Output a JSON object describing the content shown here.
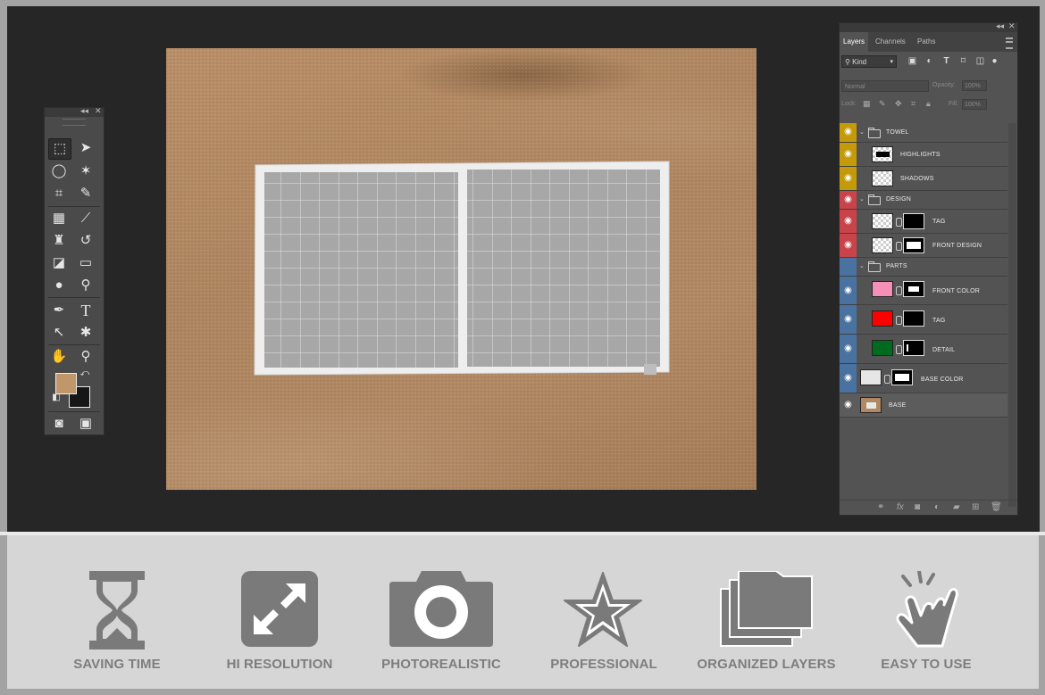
{
  "toolbar": {
    "collapse_glyph": "◂◂",
    "close_glyph": "✕",
    "tools": [
      {
        "name": "marquee-tool",
        "icon": "dashed-rectangle-icon",
        "glyph": "⬚"
      },
      {
        "name": "move-tool",
        "icon": "move-arrow-icon",
        "glyph": "➤"
      },
      {
        "name": "lasso-tool",
        "icon": "lasso-icon",
        "glyph": "◯"
      },
      {
        "name": "magic-wand-tool",
        "icon": "magic-wand-icon",
        "glyph": "✶"
      },
      {
        "name": "crop-tool",
        "icon": "crop-icon",
        "glyph": "⌗"
      },
      {
        "name": "eyedropper-tool",
        "icon": "eyedropper-icon",
        "glyph": "✎"
      },
      {
        "name": "healing-tool",
        "icon": "bandage-icon",
        "glyph": "▦"
      },
      {
        "name": "brush-tool",
        "icon": "brush-icon",
        "glyph": "⟋"
      },
      {
        "name": "stamp-tool",
        "icon": "stamp-icon",
        "glyph": "♜"
      },
      {
        "name": "history-brush-tool",
        "icon": "history-brush-icon",
        "glyph": "↺"
      },
      {
        "name": "eraser-tool",
        "icon": "eraser-icon",
        "glyph": "◪"
      },
      {
        "name": "gradient-tool",
        "icon": "gradient-icon",
        "glyph": "▭"
      },
      {
        "name": "blur-tool",
        "icon": "drop-icon",
        "glyph": "●"
      },
      {
        "name": "dodge-tool",
        "icon": "dodge-icon",
        "glyph": "⚲"
      },
      {
        "name": "pen-tool",
        "icon": "pen-icon",
        "glyph": "✒"
      },
      {
        "name": "type-tool",
        "icon": "type-icon",
        "glyph": "T"
      },
      {
        "name": "path-selection-tool",
        "icon": "arrow-icon",
        "glyph": "↖"
      },
      {
        "name": "custom-shape-tool",
        "icon": "custom-shape-icon",
        "glyph": "✱"
      },
      {
        "name": "hand-tool",
        "icon": "hand-icon",
        "glyph": "✋"
      },
      {
        "name": "zoom-tool",
        "icon": "zoom-icon",
        "glyph": "⚲"
      }
    ],
    "foreground_color": "#c0966b",
    "background_color": "#161616",
    "swap_glyph": "⤺",
    "default_glyph": "◧",
    "quick_mask_glyph": "◙",
    "screen_mode_glyph": "▣"
  },
  "layers_panel": {
    "collapse_glyph": "◂◂",
    "close_glyph": "✕",
    "tabs": [
      {
        "label": "Layers",
        "active": true
      },
      {
        "label": "Channels",
        "active": false
      },
      {
        "label": "Paths",
        "active": false
      }
    ],
    "filter_kind": "Kind",
    "filter_icons": [
      "image-filter-icon",
      "adjustment-filter-icon",
      "type-filter-icon",
      "shape-filter-icon",
      "smart-object-filter-icon"
    ],
    "blend_mode": "Normal",
    "opacity_label": "Opacity:",
    "opacity_value": "100%",
    "lock_label": "Lock:",
    "fill_label": "Fill:",
    "fill_value": "100%",
    "groups": {
      "towel": "TOWEL",
      "design": "DESIGN",
      "parts": "PARTS"
    },
    "layers": {
      "highlights": "HIGHLIGHTS",
      "shadows": "SHADOWS",
      "design_tag": "TAG",
      "front_design": "FRONT DESIGN",
      "front_color": "FRONT COLOR",
      "parts_tag": "TAG",
      "detail": "DETAIL",
      "base_color": "BASE COLOR",
      "base": "BASE"
    },
    "colors": {
      "towel_group": "#c49a0a",
      "design_group": "#c9444a",
      "parts_group": "#4a72a0",
      "front_color": "#f48fb8",
      "tag": "#ff0000",
      "detail": "#006a1f",
      "base_color": "#e6e6e6"
    }
  },
  "features": [
    {
      "label": "SAVING TIME",
      "icon": "hourglass-icon"
    },
    {
      "label": "HI RESOLUTION",
      "icon": "expand-arrows-icon"
    },
    {
      "label": "PHOTOREALISTIC",
      "icon": "camera-icon"
    },
    {
      "label": "PROFESSIONAL",
      "icon": "star-icon"
    },
    {
      "label": "ORGANIZED LAYERS",
      "icon": "stacked-folders-icon"
    },
    {
      "label": "EASY TO USE",
      "icon": "pointing-hand-icon"
    }
  ]
}
